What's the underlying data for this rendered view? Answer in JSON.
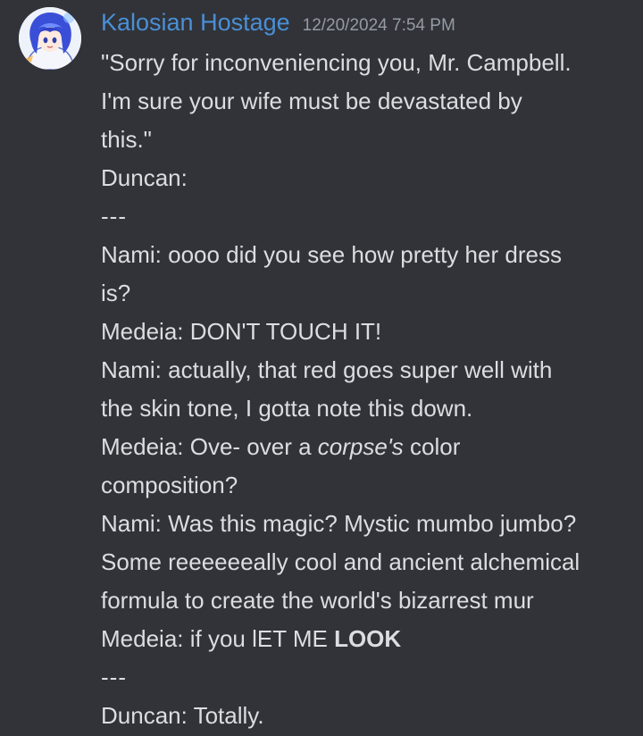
{
  "author": {
    "name": "Kalosian Hostage",
    "name_color": "#4a8fd6",
    "avatar_icon": "user-avatar-anime-character"
  },
  "timestamp": "12/20/2024 7:54 PM",
  "lines": [
    "\"Sorry for inconveniencing you, Mr. Campbell.",
    "I'm sure your wife must be devastated by",
    "this.\"",
    "Duncan:",
    "---",
    "Nami: oooo did you see how pretty her dress",
    "is?",
    "Medeia: DON'T TOUCH IT!",
    "Nami: actually, that red goes super well with",
    "the skin tone, I gotta note this down.",
    "Medeia: Ove- over a ",
    "corpse's",
    " color",
    "composition?",
    "Nami: Was this magic? Mystic mumbo jumbo?",
    "Some reeeeeeally cool and ancient alchemical",
    "formula to create the world's bizarrest mur",
    "Medeia: if you lET ME ",
    "LOOK",
    "---",
    "Duncan: Totally."
  ]
}
